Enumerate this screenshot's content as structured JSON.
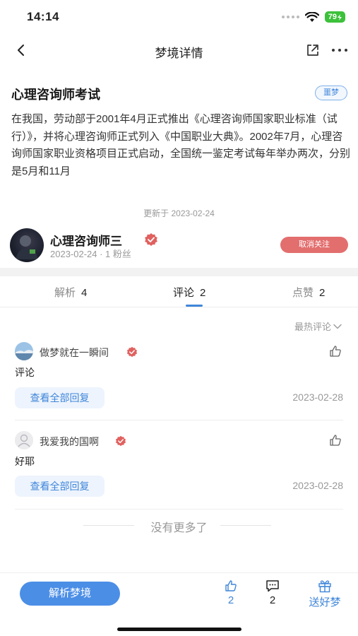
{
  "status": {
    "time": "14:14",
    "battery": "79"
  },
  "nav": {
    "title": "梦境详情"
  },
  "dream": {
    "title": "心理咨询师考试",
    "badge": "噩梦",
    "body": "在我国，劳动部于2001年4月正式推出《心理咨询师国家职业标准（试行）》，并将心理咨询师正式列入《中国职业大典》。2002年7月，心理咨询师国家职业资格项目正式启动，全国统一鉴定考试每年举办两次，分别是5月和11月",
    "updated": "更新于 2023-02-24"
  },
  "author": {
    "name": "心理咨询师三",
    "meta": "2023-02-24 · 1 粉丝",
    "unfollow_label": "取消关注"
  },
  "tabs": [
    {
      "label": "解析",
      "count": "4"
    },
    {
      "label": "评论",
      "count": "2"
    },
    {
      "label": "点赞",
      "count": "2"
    }
  ],
  "sort_label": "最热评论",
  "comments": [
    {
      "user": "做梦就在一瞬间",
      "text": "评论",
      "replies_label": "查看全部回复",
      "date": "2023-02-28"
    },
    {
      "user": "我爱我的国啊",
      "text": "好耶",
      "replies_label": "查看全部回复",
      "date": "2023-02-28"
    }
  ],
  "no_more": "没有更多了",
  "bottom": {
    "analyze_label": "解析梦境",
    "likes": "2",
    "comments": "2",
    "gift_label": "送好梦"
  },
  "colors": {
    "accent": "#3f86d9",
    "unfollow": "#e36e6e",
    "verify": "#e0615f"
  }
}
